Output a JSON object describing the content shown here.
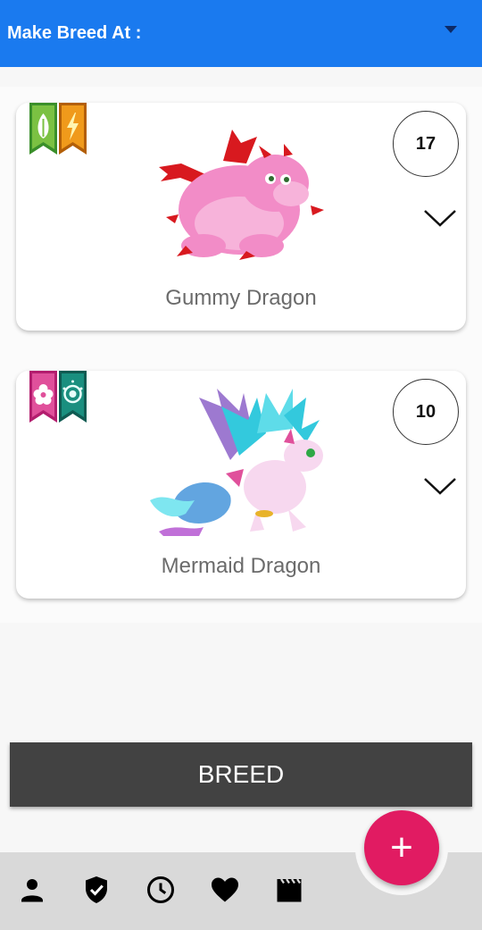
{
  "header": {
    "title": "Make Breed At :",
    "dropdown_icon": "caret-down-icon"
  },
  "dragons": [
    {
      "name": "Gummy Dragon",
      "level": "17",
      "elements": [
        "plant",
        "electric"
      ],
      "body_color": "#f28cc7",
      "wing_color": "#d8191f"
    },
    {
      "name": "Mermaid Dragon",
      "level": "10",
      "elements": [
        "flower",
        "pure"
      ],
      "body_color": "#f7d8ef",
      "wing_color": "#33c9dd"
    }
  ],
  "breed_button": {
    "label": "BREED"
  },
  "fab": {
    "label": "+"
  },
  "nav": {
    "icons": [
      "person-icon",
      "shield-check-icon",
      "clock-icon",
      "heart-icon",
      "movie-clapper-icon"
    ]
  },
  "colors": {
    "primary": "#1a7aef",
    "accent": "#e11b62",
    "button_dark": "#424242"
  }
}
